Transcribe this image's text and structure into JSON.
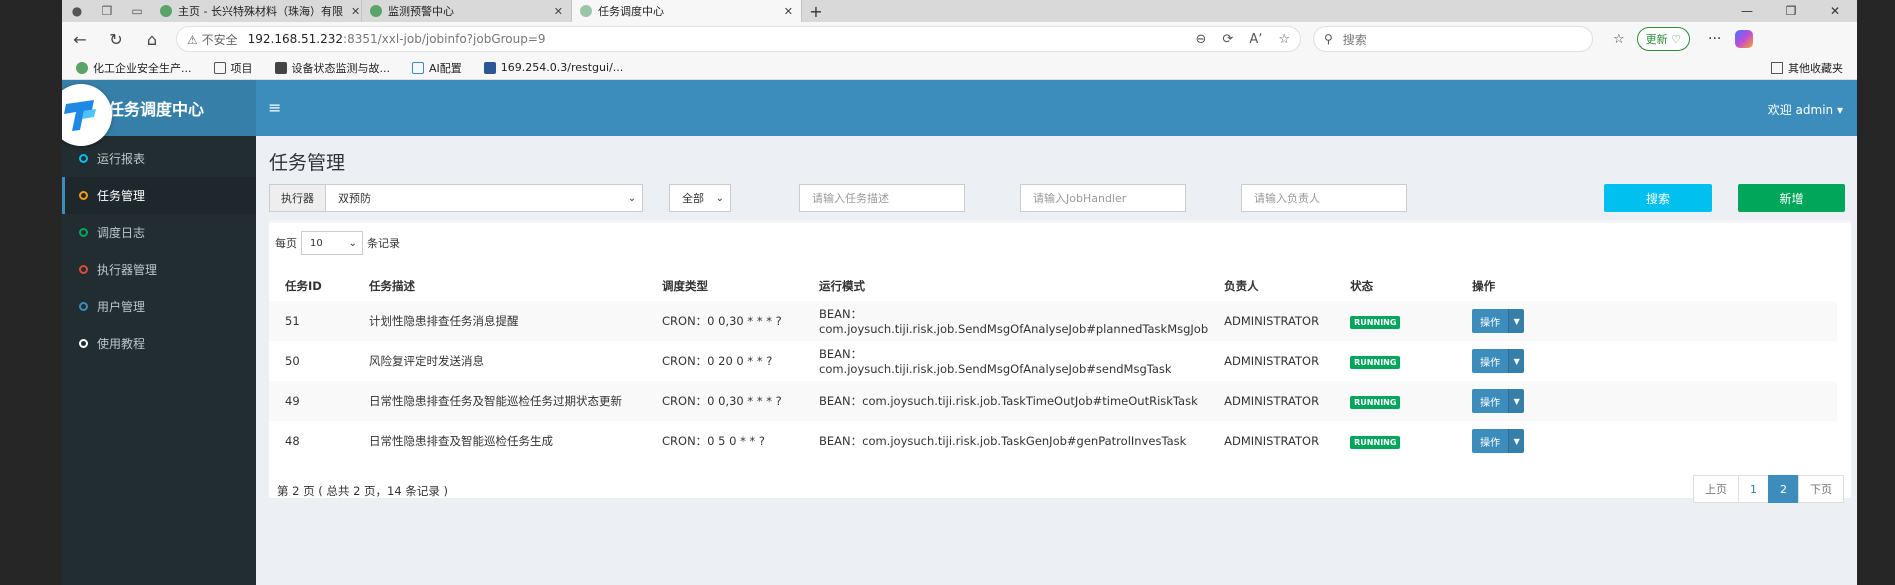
{
  "browser": {
    "tabs": [
      {
        "label": "主页 - 长兴特殊材料（珠海）有限",
        "active": false
      },
      {
        "label": "监测预警中心",
        "active": false
      },
      {
        "label": "任务调度中心",
        "active": true
      }
    ],
    "address": {
      "security": "不安全",
      "host": "192.168.51.232",
      "path": ":8351/xxl-job/jobinfo?jobGroup=9"
    },
    "search_placeholder": "搜索",
    "update_label": "更新",
    "bookmarks": [
      "化工企业安全生产...",
      "项目",
      "设备状态监测与故...",
      "AI配置",
      "169.254.0.3/restgui/..."
    ],
    "other_bookmarks": "其他收藏夹"
  },
  "app": {
    "title": "任务调度中心",
    "welcome": "欢迎 admin",
    "menu": [
      {
        "label": "运行报表",
        "color": "#00c0ef",
        "active": false
      },
      {
        "label": "任务管理",
        "color": "#f39c12",
        "active": true
      },
      {
        "label": "调度日志",
        "color": "#00a65a",
        "active": false
      },
      {
        "label": "执行器管理",
        "color": "#dd4b39",
        "active": false
      },
      {
        "label": "用户管理",
        "color": "#3c8dbc",
        "active": false
      },
      {
        "label": "使用教程",
        "color": "#ffffff",
        "active": false
      }
    ],
    "page_title": "任务管理",
    "filters": {
      "executor_label": "执行器",
      "executor_value": "双预防",
      "status_value": "全部",
      "desc_placeholder": "请输入任务描述",
      "handler_placeholder": "请输入JobHandler",
      "author_placeholder": "请输入负责人",
      "search_label": "搜索",
      "add_label": "新增"
    },
    "page_size": {
      "prefix": "每页",
      "value": "10",
      "suffix": "条记录"
    },
    "table": {
      "headers": [
        "任务ID",
        "任务描述",
        "调度类型",
        "运行模式",
        "负责人",
        "状态",
        "操作"
      ],
      "rows": [
        {
          "id": "51",
          "desc": "计划性隐患排查任务消息提醒",
          "schedule": "CRON：0 0,30 * * * ?",
          "mode": "BEAN：com.joysuch.tiji.risk.job.SendMsgOfAnalyseJob#plannedTaskMsgJob",
          "author": "ADMINISTRATOR",
          "status": "RUNNING",
          "op": "操作"
        },
        {
          "id": "50",
          "desc": "风险复评定时发送消息",
          "schedule": "CRON：0 20 0 * * ?",
          "mode": "BEAN：com.joysuch.tiji.risk.job.SendMsgOfAnalyseJob#sendMsgTask",
          "author": "ADMINISTRATOR",
          "status": "RUNNING",
          "op": "操作"
        },
        {
          "id": "49",
          "desc": "日常性隐患排查任务及智能巡检任务过期状态更新",
          "schedule": "CRON：0 0,30 * * * ?",
          "mode": "BEAN：com.joysuch.tiji.risk.job.TaskTimeOutJob#timeOutRiskTask",
          "author": "ADMINISTRATOR",
          "status": "RUNNING",
          "op": "操作"
        },
        {
          "id": "48",
          "desc": "日常性隐患排查及智能巡检任务生成",
          "schedule": "CRON：0 5 0 * * ?",
          "mode": "BEAN：com.joysuch.tiji.risk.job.TaskGenJob#genPatrolInvesTask",
          "author": "ADMINISTRATOR",
          "status": "RUNNING",
          "op": "操作"
        }
      ]
    },
    "page_info": "第 2 页 ( 总共 2 页，14 条记录 )",
    "pager": {
      "prev": "上页",
      "pages": [
        "1",
        "2"
      ],
      "current": "2",
      "next": "下页"
    }
  }
}
